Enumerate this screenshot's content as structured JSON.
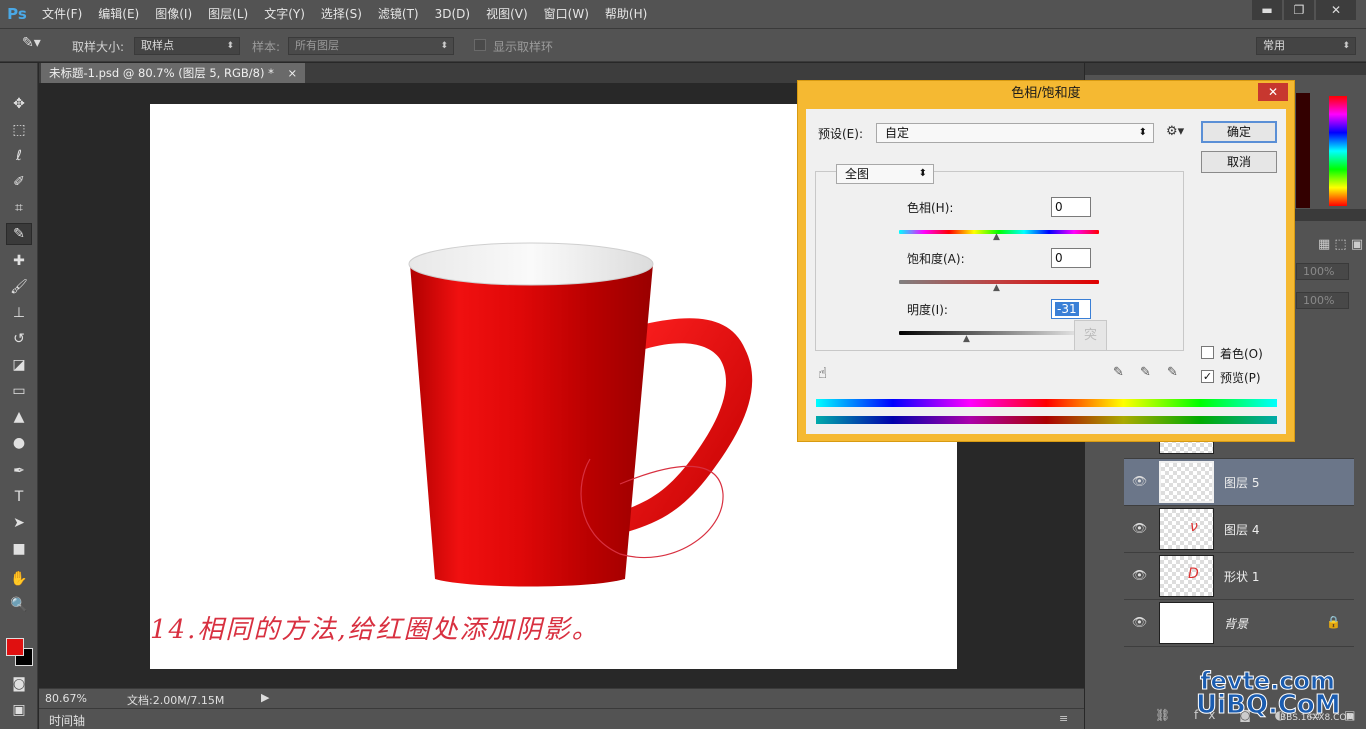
{
  "app": {
    "logo": "Ps"
  },
  "menu": [
    "文件(F)",
    "编辑(E)",
    "图像(I)",
    "图层(L)",
    "文字(Y)",
    "选择(S)",
    "滤镜(T)",
    "3D(D)",
    "视图(V)",
    "窗口(W)",
    "帮助(H)"
  ],
  "window_controls": {
    "minimize": "▬",
    "maximize": "❐",
    "close": "✕"
  },
  "options": {
    "sample_size_label": "取样大小:",
    "sample_size_value": "取样点",
    "sample_label": "样本:",
    "sample_value": "所有图层",
    "show_ring_label": "显示取样环",
    "workspace": "常用"
  },
  "document": {
    "tab_title": "未标题-1.psd @ 80.7% (图层 5, RGB/8) *",
    "tab_close": "×",
    "annotation": "14.相同的方法,给红圈处添加阴影。"
  },
  "status": {
    "zoom": "80.67%",
    "doc_size": "文档:2.00M/7.15M"
  },
  "timeline_label": "时间轴",
  "layers_panel": {
    "opacity": "100%",
    "fill": "100%",
    "layers": [
      {
        "name": "图层 5",
        "selected": true,
        "thumb_char": ""
      },
      {
        "name": "图层 4",
        "selected": false,
        "thumb_char": "ν"
      },
      {
        "name": "形状 1",
        "selected": false,
        "thumb_char": "D"
      },
      {
        "name": "背景",
        "selected": false,
        "thumb_char": ""
      }
    ]
  },
  "dialog": {
    "title": "色相/饱和度",
    "close": "✕",
    "preset_label": "预设(E):",
    "preset_value": "自定",
    "channel_value": "全图",
    "ok": "确定",
    "cancel": "取消",
    "hue_label": "色相(H):",
    "hue_value": "0",
    "saturation_label": "饱和度(A):",
    "saturation_value": "0",
    "lightness_label": "明度(I):",
    "lightness_value": "-31",
    "colorize_label": "着色(O)",
    "preview_label": "预览(P)",
    "preview_checked": "✓",
    "tooltip_char": "突"
  },
  "watermark": {
    "line1": "fevte.com",
    "line2": "UiBQ.CoM",
    "line3": "BBS.16XX8.COM"
  },
  "colors": {
    "foreground": "#e01010",
    "background": "#000000",
    "dialog_frame": "#f5b932",
    "selected_layer": "#6b7689",
    "annotation": "#d83040"
  }
}
